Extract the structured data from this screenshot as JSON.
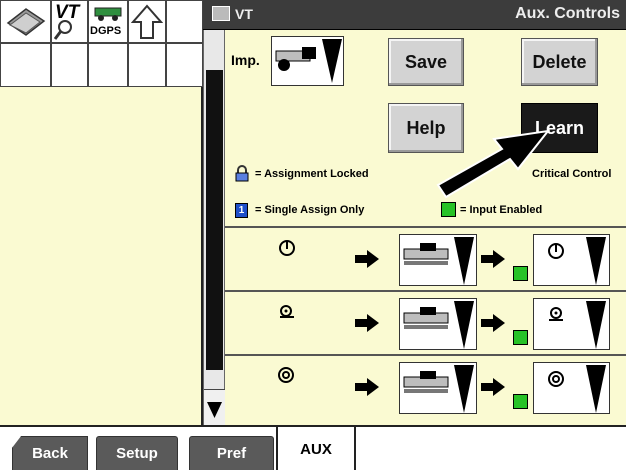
{
  "left_panel": {
    "vt_label": "VT",
    "dgps_label": "DGPS",
    "icons": [
      "book-icon",
      "magnifier-icon",
      "tractor-icon",
      "up-arrow-icon"
    ]
  },
  "title_bar": {
    "left": "VT",
    "right": "Aux. Controls"
  },
  "implement": {
    "label": "Imp."
  },
  "buttons": {
    "save": "Save",
    "delete": "Delete",
    "help": "Help",
    "learn": "Learn"
  },
  "legend": {
    "locked": "= Assignment Locked",
    "critical": "Critical Control",
    "single": "= Single Assign Only",
    "single_glyph": "1",
    "enabled": "= Input Enabled"
  },
  "rows": [
    {
      "function_icon": "power-icon"
    },
    {
      "function_icon": "gear-pointer-icon"
    },
    {
      "function_icon": "disc-icon"
    }
  ],
  "tabs": {
    "back": "Back",
    "setup": "Setup",
    "pref": "Pref",
    "aux": "AUX"
  },
  "colors": {
    "panel_bg": "#fafad2",
    "title_bar": "#3c3c3c",
    "enabled_green": "#27c227",
    "single_blue": "#1e4fc9"
  }
}
